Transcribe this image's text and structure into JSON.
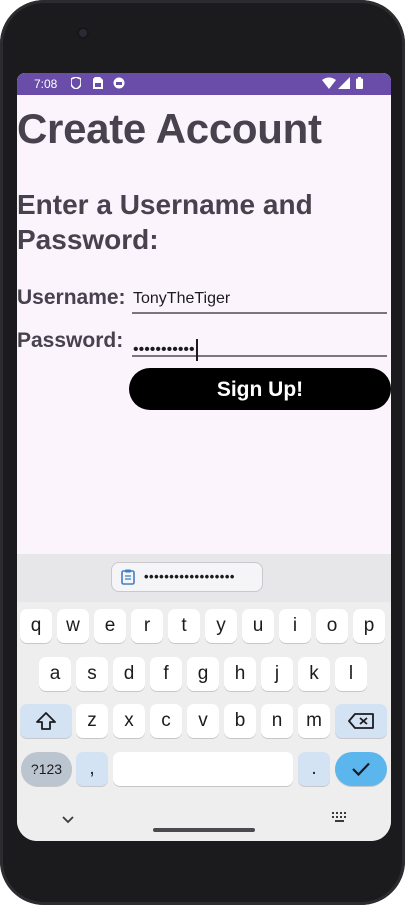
{
  "status_bar": {
    "time": "7:08"
  },
  "app": {
    "title": "Create Account",
    "subtitle": "Enter a Username and Password:",
    "username_label": "Username:",
    "username_value": "TonyTheTiger",
    "password_label": "Password:",
    "password_masked": "•••••••••••",
    "signup_label": "Sign Up!"
  },
  "keyboard": {
    "clipboard_suggestion": "••••••••••••••••••",
    "row1": [
      "q",
      "w",
      "e",
      "r",
      "t",
      "y",
      "u",
      "i",
      "o",
      "p"
    ],
    "row2": [
      "a",
      "s",
      "d",
      "f",
      "g",
      "h",
      "j",
      "k",
      "l"
    ],
    "row3": [
      "z",
      "x",
      "c",
      "v",
      "b",
      "n",
      "m"
    ],
    "symbols_label": "?123",
    "comma_label": ",",
    "period_label": "."
  },
  "colors": {
    "status_bar": "#6a4da8",
    "screen_background": "#fcf4fc",
    "text": "#47424e",
    "button": "#000000",
    "enter_key": "#5bb6ee"
  }
}
